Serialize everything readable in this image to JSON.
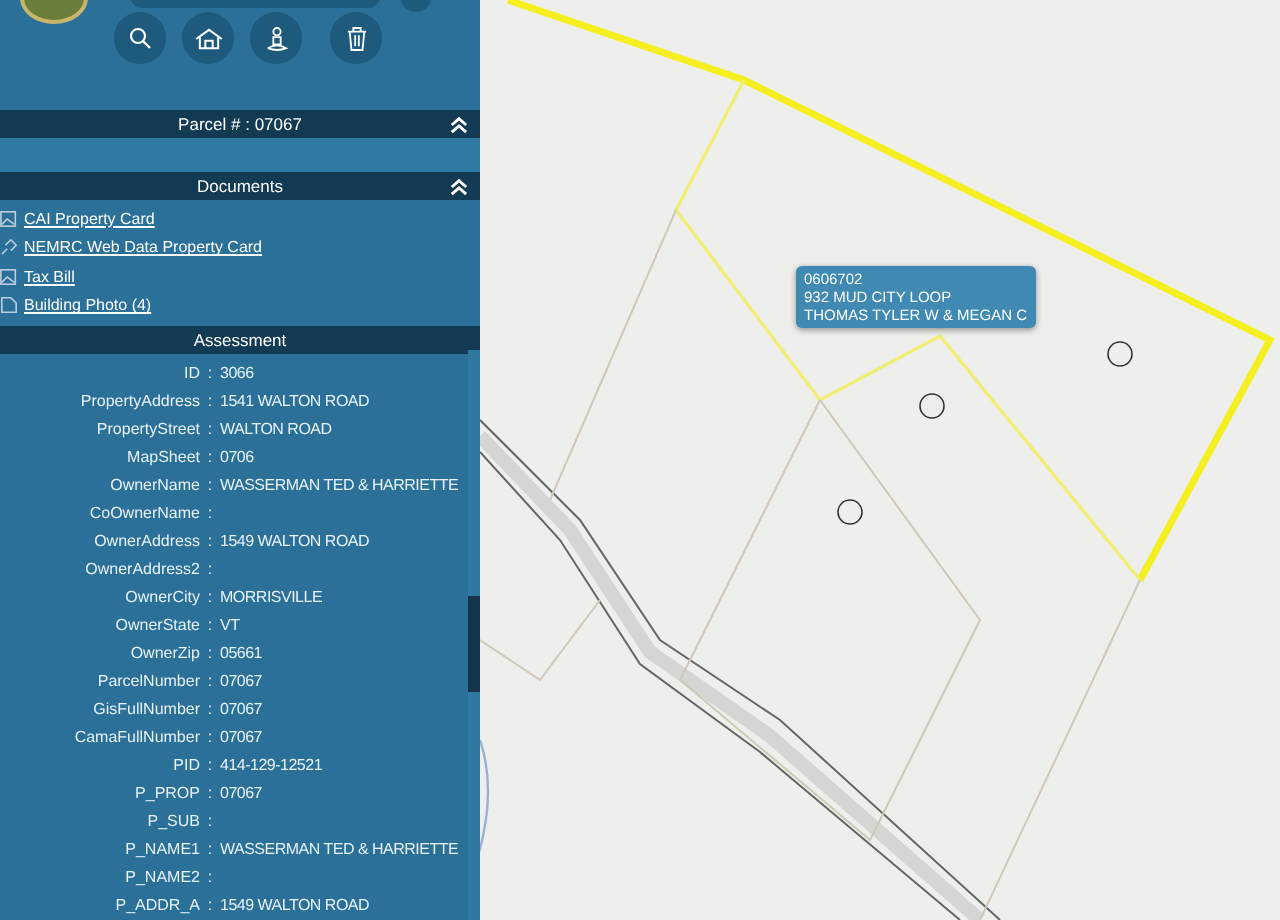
{
  "parcel_section": {
    "title": "Parcel # : 07067",
    "expanded": true
  },
  "documents": {
    "title": "Documents",
    "expanded": true,
    "links": [
      {
        "label": "CAI Property Card",
        "kind": "image"
      },
      {
        "label": "NEMRC Web Data Property Card",
        "kind": "link"
      },
      {
        "label": "Tax Bill",
        "kind": "image"
      },
      {
        "label": "Building Photo (4)",
        "kind": "attachment"
      }
    ]
  },
  "assessment": {
    "title": "Assessment",
    "separator": ":",
    "fields": [
      {
        "label": "ID",
        "value": "3066"
      },
      {
        "label": "PropertyAddress",
        "value": "1541 WALTON ROAD"
      },
      {
        "label": "PropertyStreet",
        "value": "WALTON ROAD"
      },
      {
        "label": "MapSheet",
        "value": "0706"
      },
      {
        "label": "OwnerName",
        "value": "WASSERMAN TED & HARRIETTE"
      },
      {
        "label": "CoOwnerName"
      },
      {
        "label": "OwnerAddress",
        "value": "1549 WALTON ROAD"
      },
      {
        "label": "OwnerAddress2"
      },
      {
        "label": "OwnerCity",
        "value": "MORRISVILLE"
      },
      {
        "label": "OwnerState",
        "value": "VT"
      },
      {
        "label": "OwnerZip",
        "value": "05661"
      },
      {
        "label": "ParcelNumber",
        "value": "07067"
      },
      {
        "label": "GisFullNumber",
        "value": "07067"
      },
      {
        "label": "CamaFullNumber",
        "value": "07067"
      },
      {
        "label": "PID",
        "value": "414-129-12521"
      },
      {
        "label": "P_PROP",
        "value": "07067"
      },
      {
        "label": "P_SUB"
      },
      {
        "label": "P_NAME1",
        "value": "WASSERMAN TED & HARRIETTE"
      },
      {
        "label": "P_NAME2"
      },
      {
        "label": "P_ADDR_A",
        "value": "1549 WALTON ROAD"
      }
    ]
  },
  "map_tooltip": {
    "lines": [
      "0606702",
      "932 MUD CITY LOOP",
      "THOMAS TYLER W & MEGAN C"
    ]
  }
}
